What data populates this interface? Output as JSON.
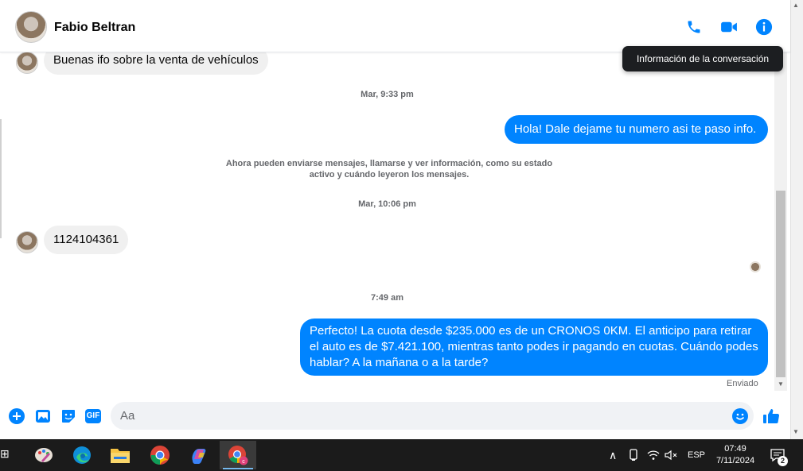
{
  "header": {
    "contact_name": "Fabio Beltran",
    "tooltip": "Información de la conversación"
  },
  "messages": {
    "first_incoming": "Buenas ifo sobre la venta de vehículos",
    "timestamp_1": "Mar, 9:33 pm",
    "outgoing_1": "Hola! Dale dejame tu numero  asi te paso info.",
    "system_notice": "Ahora pueden enviarse mensajes, llamarse y ver información, como su estado activo y cuándo leyeron los mensajes.",
    "timestamp_2": "Mar, 10:06 pm",
    "incoming_2": "1124104361",
    "timestamp_3": "7:49 am",
    "outgoing_2": "Perfecto! La cuota desde $235.000 es de un CRONOS 0KM. El anticipo para retirar el auto es de $7.421.100, mientras tanto podes ir pagando en cuotas. Cuándo podes hablar? A la mañana o a la tarde?",
    "sent_status": "Enviado"
  },
  "composer": {
    "placeholder": "Aa",
    "gif_label": "GIF"
  },
  "taskbar": {
    "language": "ESP",
    "time": "07:49",
    "date": "7/11/2024",
    "notification_count": "2"
  },
  "colors": {
    "accent": "#0084ff",
    "incoming_bubble": "#f0f0f0",
    "taskbar": "#1b1b1b"
  }
}
